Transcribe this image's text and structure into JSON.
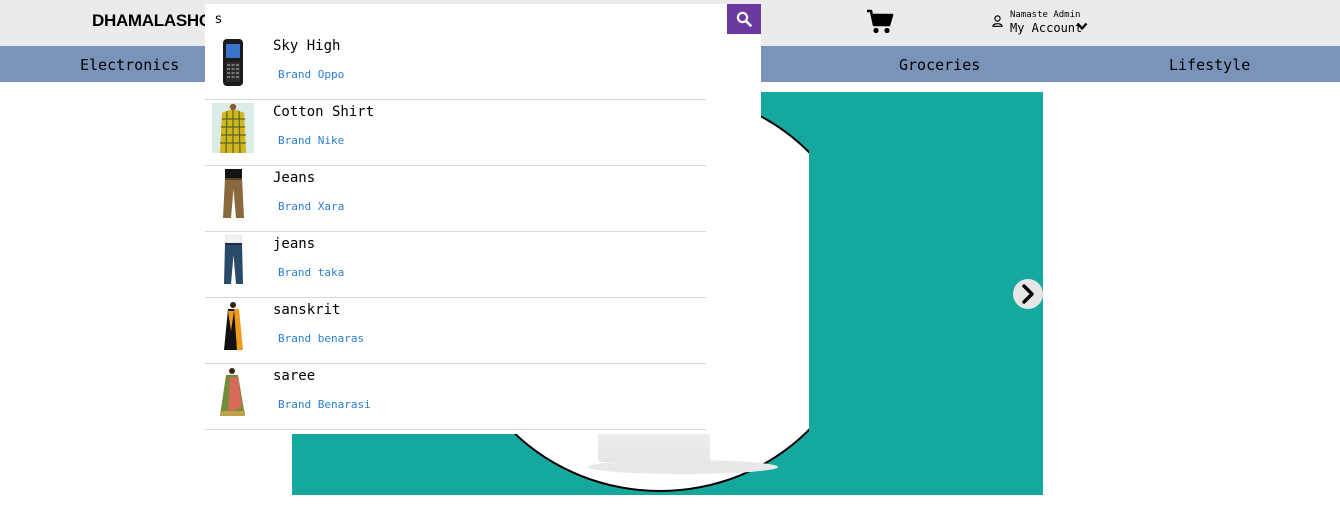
{
  "header": {
    "logo": "DHAMALASHOP",
    "search": {
      "value": "s",
      "placeholder": ""
    },
    "account": {
      "greeting": "Namaste Admin",
      "label": "My Account"
    }
  },
  "categories": [
    "Electronics",
    "",
    "",
    "Groceries",
    "Lifestyle"
  ],
  "suggestions": [
    {
      "name": "Sky High",
      "brand": "Brand Oppo",
      "icon": "mobile-phone"
    },
    {
      "name": "Cotton Shirt",
      "brand": "Brand Nike",
      "icon": "shirt"
    },
    {
      "name": "Jeans",
      "brand": "Brand Xara",
      "icon": "trousers"
    },
    {
      "name": "jeans",
      "brand": "Brand taka",
      "icon": "jeans"
    },
    {
      "name": "sanskrit",
      "brand": "Brand benaras",
      "icon": "saree"
    },
    {
      "name": "saree",
      "brand": "Brand Benarasi",
      "icon": "saree"
    }
  ],
  "colors": {
    "topbar": "#ebebeb",
    "category_bar": "#7b93b9",
    "search_button": "#6b3aa0",
    "banner": "#15a89e",
    "brand_link": "#2a7fd4"
  }
}
